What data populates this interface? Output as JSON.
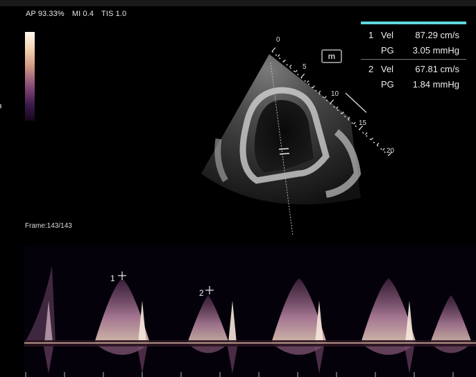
{
  "header": {
    "ap": "AP 93.33%",
    "mi": "MI 0.4",
    "tis": "TIS 1.0"
  },
  "badge": {
    "label": "m"
  },
  "depth_marks": [
    "0",
    "5",
    "10",
    "15",
    "20"
  ],
  "measurements": [
    {
      "index": "1",
      "vel_label": "Vel",
      "vel_value": "87.29 cm/s",
      "pg_label": "PG",
      "pg_value": "3.05 mmHg"
    },
    {
      "index": "2",
      "vel_label": "Vel",
      "vel_value": "67.81 cm/s",
      "pg_label": "PG",
      "pg_value": "1.84 mmHg"
    }
  ],
  "frame": {
    "label": "Frame:143/143"
  },
  "cursors": [
    {
      "label": "1"
    },
    {
      "label": "2"
    }
  ],
  "colors": {
    "accent": "#5fd6de",
    "baseline": "#d8b7a4",
    "spectral": "#c08aa8"
  }
}
